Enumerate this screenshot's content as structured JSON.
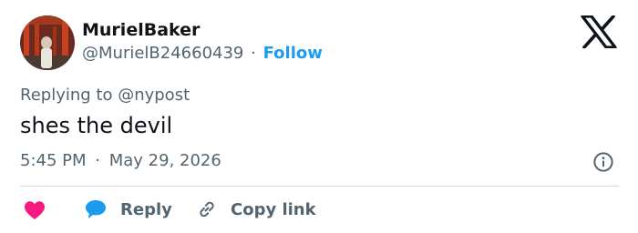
{
  "author": {
    "display_name": "MurielBaker",
    "handle": "@MurielB24660439",
    "separator": "·",
    "follow_label": "Follow"
  },
  "reply_context": {
    "label": "Replying to @nypost"
  },
  "tweet": {
    "text": "shes the devil",
    "time": "5:45 PM",
    "separator": "·",
    "date": "May 29, 2026"
  },
  "actions": {
    "reply_label": "Reply",
    "copy_link_label": "Copy link"
  },
  "icons": {
    "platform_logo": "x-logo-icon",
    "info": "info-icon",
    "like": "heart-icon",
    "reply": "speech-bubble-icon",
    "copy_link": "link-icon"
  },
  "colors": {
    "text_primary": "#0f1419",
    "text_secondary": "#536471",
    "accent": "#1d9bf0",
    "like": "#f91880",
    "divider": "#cfd9de"
  }
}
